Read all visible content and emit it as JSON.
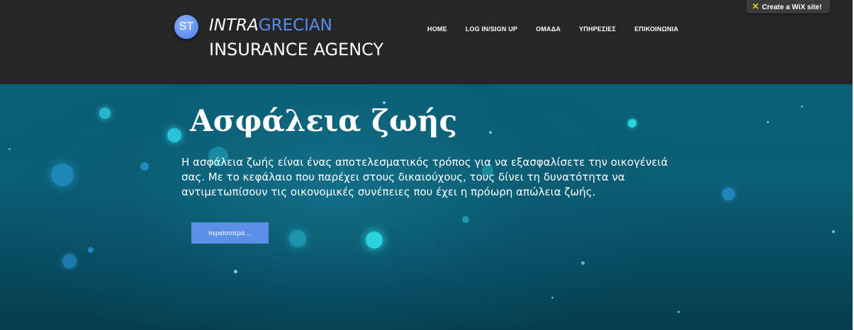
{
  "header": {
    "logo_initials": "ST",
    "brand_first": "INTRA",
    "brand_second": "GRECIAN",
    "brand_subtitle": "INSURANCE AGENCY",
    "nav": [
      "HOME",
      "LOG IN/SIGN UP",
      "ΟΜΑΔΑ",
      "ΥΠΗΡΕΣΙΕΣ",
      "ΕΠΙΚΟΙΝΩΝΙΑ"
    ]
  },
  "wix_badge": {
    "label": "Create a WiX site!",
    "icon": "wix-x-icon"
  },
  "hero": {
    "title": "Ασφάλεια ζωής",
    "text": "Η ασφάλεια ζωής είναι ένας αποτελεσματικός τρόπος για να εξασφαλίσετε την οικογένειά σας. Με το κεφάλαιο που παρέχει στους δικαιούχους, τους δίνει τη δυνατότητα να αντιμετωπίσουν τις οικονομικές συνέπειες που έχει η πρόωρη απώλεια ζωής.",
    "button_label": "περισσοτερα...."
  },
  "colors": {
    "header_bg": "#262626",
    "brand_accent": "#5b8cf0",
    "hero_bg": "#0b5e74",
    "button_bg": "#5b8fe8",
    "bokeh": "#2fd4e8"
  }
}
